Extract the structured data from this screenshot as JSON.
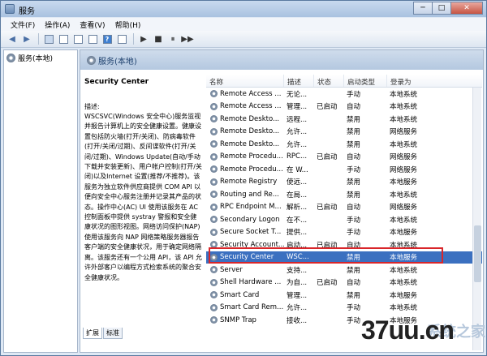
{
  "window": {
    "title": "服务",
    "min": "─",
    "max": "□",
    "close": "✕"
  },
  "menu": [
    "文件(F)",
    "操作(A)",
    "查看(V)",
    "帮助(H)"
  ],
  "toolbar": {
    "back": "◀",
    "forward": "▶",
    "help": "?",
    "play": "▶",
    "stop": "■",
    "pause": "⏸",
    "restart": "▶▶"
  },
  "tree": {
    "label": "服务(本地)"
  },
  "panel": {
    "header": "服务(本地)"
  },
  "description": {
    "title": "Security Center",
    "label": "描述:",
    "text": "WSCSVC(Windows 安全中心)服务监视并报告计算机上的安全健康设置。健康设置包括防火墙(打开/关闭)、防病毒软件(打开/关闭/过期)、反间谍软件(打开/关闭/过期)、Windows Update(自动/手动下载并安装更新)、用户帐户控制(打开/关闭)以及Internet 设置(推荐/不推荐)。该服务为独立软件供应商提供 COM API 以便向安全中心服务注册并记录其产品的状态。操作中心(AC) UI 使用该服务在 AC 控制面板中提供 systray 警报和安全健康状况的图形视图。网络访问保护(NAP)使用该服务向 NAP 网络策略服务器报告客户端的安全健康状况，用于确定网络隔离。该服务还有一个公用 API，该 API 允许外部客户以编程方式检索系统的聚合安全健康状况。"
  },
  "tabs": [
    "扩展",
    "标准"
  ],
  "columns": [
    "名称",
    "描述",
    "状态",
    "启动类型",
    "登录为"
  ],
  "rows": [
    {
      "name": "Remote Access ...",
      "desc": "无论...",
      "status": "",
      "startup": "手动",
      "logon": "本地系统"
    },
    {
      "name": "Remote Access ...",
      "desc": "管理...",
      "status": "已启动",
      "startup": "自动",
      "logon": "本地系统"
    },
    {
      "name": "Remote Deskto...",
      "desc": "远程...",
      "status": "",
      "startup": "禁用",
      "logon": "本地系统"
    },
    {
      "name": "Remote Deskto...",
      "desc": "允许...",
      "status": "",
      "startup": "禁用",
      "logon": "网络服务"
    },
    {
      "name": "Remote Deskto...",
      "desc": "允许...",
      "status": "",
      "startup": "禁用",
      "logon": "本地系统"
    },
    {
      "name": "Remote Procedu...",
      "desc": "RPC...",
      "status": "已启动",
      "startup": "自动",
      "logon": "网络服务"
    },
    {
      "name": "Remote Procedu...",
      "desc": "在 W...",
      "status": "",
      "startup": "手动",
      "logon": "网络服务"
    },
    {
      "name": "Remote Registry",
      "desc": "使远...",
      "status": "",
      "startup": "禁用",
      "logon": "本地服务"
    },
    {
      "name": "Routing and Re...",
      "desc": "在局...",
      "status": "",
      "startup": "禁用",
      "logon": "本地系统"
    },
    {
      "name": "RPC Endpoint M...",
      "desc": "解析...",
      "status": "已启动",
      "startup": "自动",
      "logon": "网络服务"
    },
    {
      "name": "Secondary Logon",
      "desc": "在不...",
      "status": "",
      "startup": "手动",
      "logon": "本地系统"
    },
    {
      "name": "Secure Socket T...",
      "desc": "提供...",
      "status": "",
      "startup": "手动",
      "logon": "本地服务"
    },
    {
      "name": "Security Account...",
      "desc": "启动...",
      "status": "已启动",
      "startup": "自动",
      "logon": "本地系统"
    },
    {
      "name": "Security Center",
      "desc": "WSC...",
      "status": "",
      "startup": "禁用",
      "logon": "本地服务",
      "selected": true
    },
    {
      "name": "Server",
      "desc": "支持...",
      "status": "",
      "startup": "禁用",
      "logon": "本地系统"
    },
    {
      "name": "Shell Hardware ...",
      "desc": "为自...",
      "status": "已启动",
      "startup": "自动",
      "logon": "本地系统"
    },
    {
      "name": "Smart Card",
      "desc": "管理...",
      "status": "",
      "startup": "禁用",
      "logon": "本地服务"
    },
    {
      "name": "Smart Card Rem...",
      "desc": "允许...",
      "status": "",
      "startup": "手动",
      "logon": "本地系统"
    },
    {
      "name": "SNMP Trap",
      "desc": "接收...",
      "status": "",
      "startup": "手动",
      "logon": "本地服务"
    }
  ],
  "watermark": {
    "main": "37uu.cn",
    "faint": "系统之家"
  }
}
